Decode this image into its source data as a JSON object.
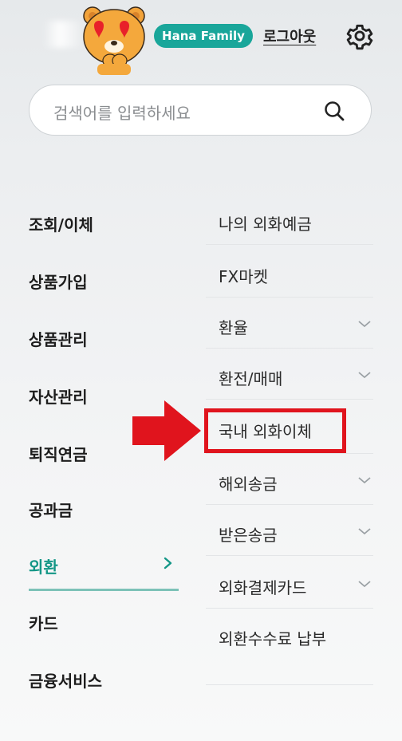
{
  "header": {
    "badge": "Hana Family",
    "logout_label": "로그아웃",
    "avatar_icon": "bear-character-heart-eyes-icon",
    "settings_icon": "gear-icon"
  },
  "search": {
    "placeholder": "검색어를 입력하세요",
    "icon": "search-icon"
  },
  "left_menu": {
    "items": [
      "조회/이체",
      "상품가입",
      "상품관리",
      "자산관리",
      "퇴직연금",
      "공과금",
      "외환",
      "카드",
      "금융서비스"
    ],
    "active": "외환"
  },
  "right_menu": {
    "items": [
      {
        "label": "나의 외화예금",
        "expandable": false
      },
      {
        "label": "FX마켓",
        "expandable": false
      },
      {
        "label": "환율",
        "expandable": true
      },
      {
        "label": "환전/매매",
        "expandable": true
      },
      {
        "label": "국내 외화이체",
        "expandable": false,
        "highlighted": true
      },
      {
        "label": "해외송금",
        "expandable": true
      },
      {
        "label": "받은송금",
        "expandable": true
      },
      {
        "label": "외화결제카드",
        "expandable": true
      },
      {
        "label": "외환수수료 납부",
        "expandable": false
      }
    ]
  },
  "colors": {
    "accent": "#139686",
    "badge_bg": "#19a69a",
    "highlight": "#e0141d"
  }
}
